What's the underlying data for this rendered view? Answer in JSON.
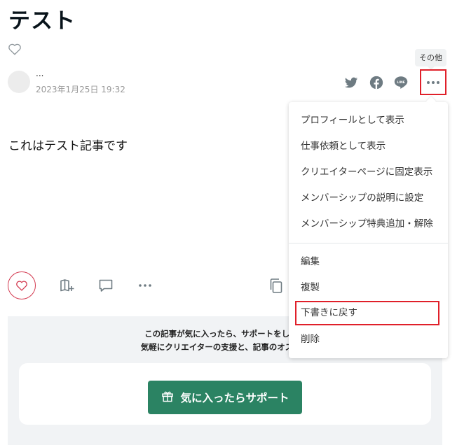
{
  "article": {
    "title": "テスト",
    "author_name": "...",
    "date": "2023年1月25日 19:32",
    "body": "これはテスト記事です"
  },
  "share": {
    "icons": [
      "twitter-icon",
      "facebook-icon",
      "line-icon"
    ],
    "line_label": "LINE"
  },
  "more_menu": {
    "tooltip": "その他",
    "group1": [
      "プロフィールとして表示",
      "仕事依頼として表示",
      "クリエイターページに固定表示",
      "メンバーシップの説明に設定",
      "メンバーシップ特典追加・解除"
    ],
    "group2": [
      "編集",
      "複製",
      "下書きに戻す",
      "削除"
    ],
    "highlighted_item": "下書きに戻す"
  },
  "support": {
    "message_line1": "この記事が気に入ったら、サポートをしてみ",
    "message_line2": "気軽にクリエイターの支援と、記事のオススメ",
    "button_label": "気に入ったらサポート"
  },
  "colors": {
    "like_red": "#d3394f",
    "highlight_red": "#e0202a",
    "support_green": "#2b8363",
    "icon_gray": "#6e7b82"
  }
}
